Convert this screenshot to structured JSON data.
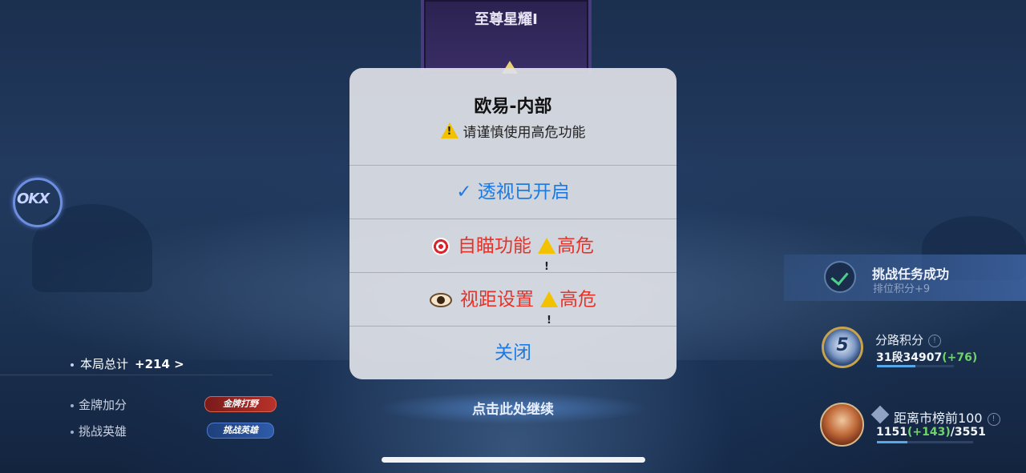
{
  "banner": {
    "rank_title": "至尊星耀Ⅰ"
  },
  "logo": {
    "text": "OKX"
  },
  "stats": {
    "total_label": "本局总计",
    "total_value": "+214 >",
    "rows": [
      {
        "label": "金牌加分",
        "badge": "金牌打野"
      },
      {
        "label": "挑战英雄",
        "badge": "挑战英雄"
      }
    ]
  },
  "continue": {
    "text": "点击此处继续"
  },
  "challenge": {
    "title": "挑战任务成功",
    "subtitle": "排位积分+9"
  },
  "lane": {
    "icon_number": "5",
    "title": "分路积分",
    "score_prefix": "31段34907",
    "score_delta": "(+76)"
  },
  "city": {
    "title": "距离市榜前100",
    "score_prefix": "1151",
    "score_delta": "(+143)",
    "score_suffix": "/3551"
  },
  "modal": {
    "title": "欧易-内部",
    "message": "请谨慎使用高危功能",
    "buttons": {
      "esp": "✓ 透视已开启",
      "aimbot": "自瞄功能",
      "aimbot_tag": "高危",
      "fov": "视距设置",
      "fov_tag": "高危",
      "close": "关闭"
    }
  },
  "colors": {
    "accent_blue": "#1f7ae0",
    "danger_red": "#e5332a",
    "positive_green": "#6fd36b"
  },
  "icons": {
    "warning": "warning-icon",
    "target": "target-icon",
    "eye": "eye-icon",
    "check": "check-icon",
    "info": "info-icon"
  }
}
